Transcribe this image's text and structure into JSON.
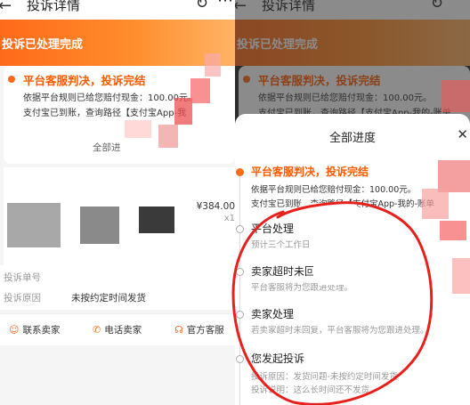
{
  "nav": {
    "title": "投诉详情",
    "back_icon": "arrow-left-icon",
    "refresh_icon": "refresh-icon",
    "more_icon": "more-icon"
  },
  "banner": {
    "status": "投诉已处理完成"
  },
  "result_card": {
    "heading": "平台客服判决，投诉完结",
    "line1": "依据平台规则已给您赔付现金：100.00元。",
    "line2": "支付宝已到账，查询路径【支付宝App-我",
    "line2_right": "支付宝已到账，查询路径【支付宝App-我的-账单",
    "all_progress": "全部进"
  },
  "product": {
    "price": "¥384.00",
    "qty": "x1"
  },
  "info": {
    "order_label": "投诉单号",
    "reason_label": "投诉原因",
    "reason_value": "未按约定时间发货"
  },
  "actions": {
    "contact_seller": "联系卖家",
    "call_seller": "电话卖家",
    "official_service": "官方客服"
  },
  "progress_sheet": {
    "title": "全部进度",
    "steps": [
      {
        "title": "平台客服判决，投诉完结",
        "desc1": "依据平台规则已给您赔付现金：100.00元。",
        "desc2": "支付宝已到账，查询路径【支付宝App-我的-账单"
      },
      {
        "title": "平台处理",
        "desc1": "预计三个工作日"
      },
      {
        "title": "卖家超时未回",
        "desc1": "平台客服将为您跟进处理。"
      },
      {
        "title": "卖家处理",
        "desc1": "若卖家超时未回复，平台客服将为您跟进处理。"
      },
      {
        "title": "您发起投诉",
        "desc1": "投诉原因：发货问题-未按约定时间发货",
        "desc2": "投诉说明：这么长时间还不发货"
      }
    ]
  },
  "colors": {
    "accent": "#ff6a1a",
    "annotation": "#e8201c"
  }
}
